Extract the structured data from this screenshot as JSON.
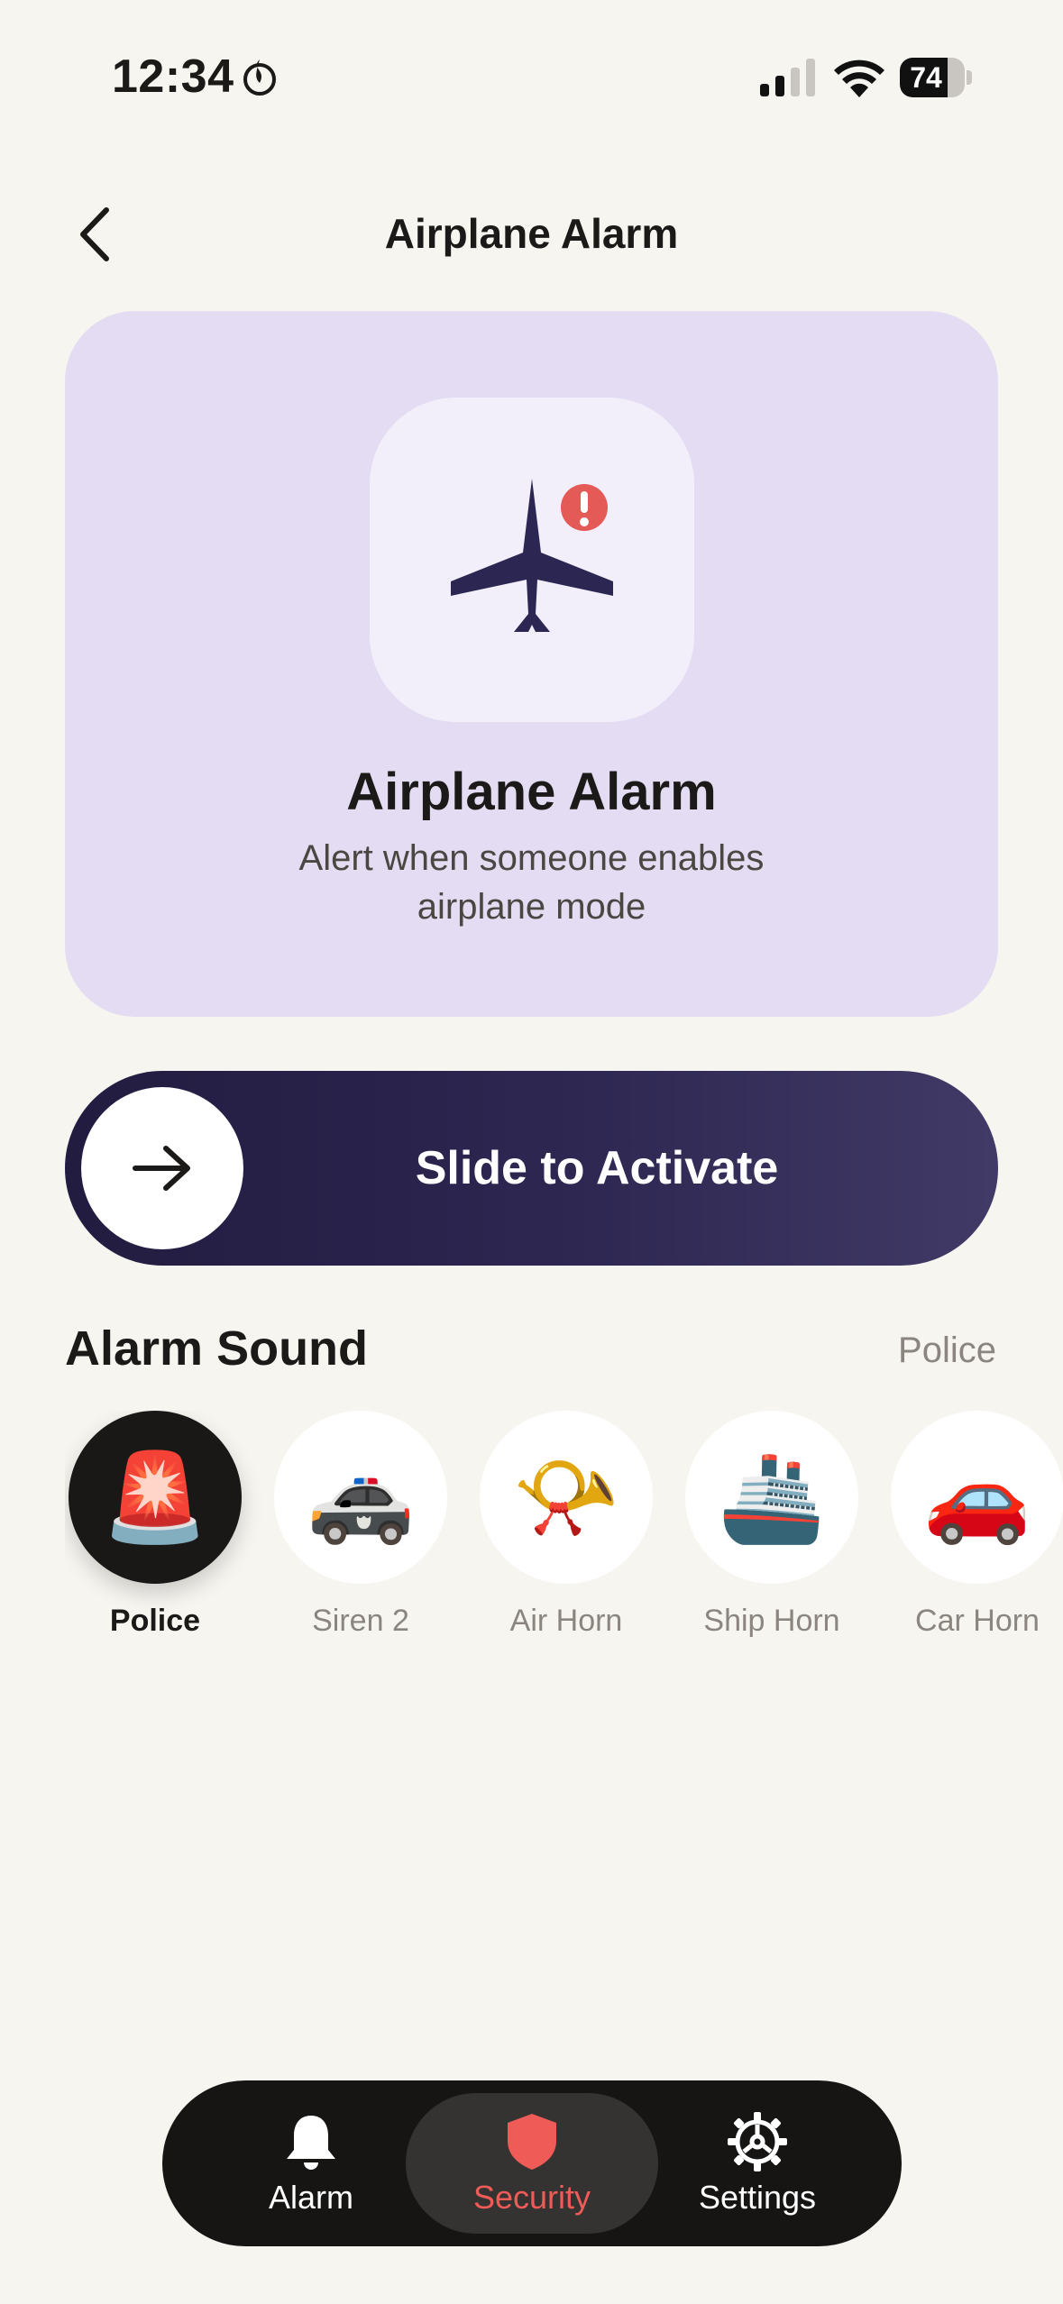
{
  "status_bar": {
    "time": "12:34",
    "battery_level": "74",
    "battery_fraction": 0.74
  },
  "header": {
    "title": "Airplane Alarm"
  },
  "hero": {
    "title": "Airplane Alarm",
    "subtitle": "Alert when someone enables airplane mode",
    "icon": "airplane-alert-icon",
    "card_color": "#e3dcf2",
    "icon_color": "#2b2752",
    "alert_color": "#e35a57"
  },
  "slider": {
    "label": "Slide to Activate"
  },
  "alarm_sound": {
    "title": "Alarm Sound",
    "selected": "Police",
    "options": [
      {
        "label": "Police",
        "emoji": "🚨",
        "selected": true
      },
      {
        "label": "Siren 2",
        "emoji": "🚓",
        "selected": false
      },
      {
        "label": "Air Horn",
        "emoji": "📯",
        "selected": false
      },
      {
        "label": "Ship Horn",
        "emoji": "🚢",
        "selected": false
      },
      {
        "label": "Car Horn",
        "emoji": "🚗",
        "selected": false
      }
    ]
  },
  "tab_bar": {
    "tabs": [
      {
        "label": "Alarm",
        "icon": "bell-icon",
        "active": false
      },
      {
        "label": "Security",
        "icon": "shield-icon",
        "active": true
      },
      {
        "label": "Settings",
        "icon": "gear-icon",
        "active": false
      }
    ],
    "active_color": "#ef5b57"
  }
}
